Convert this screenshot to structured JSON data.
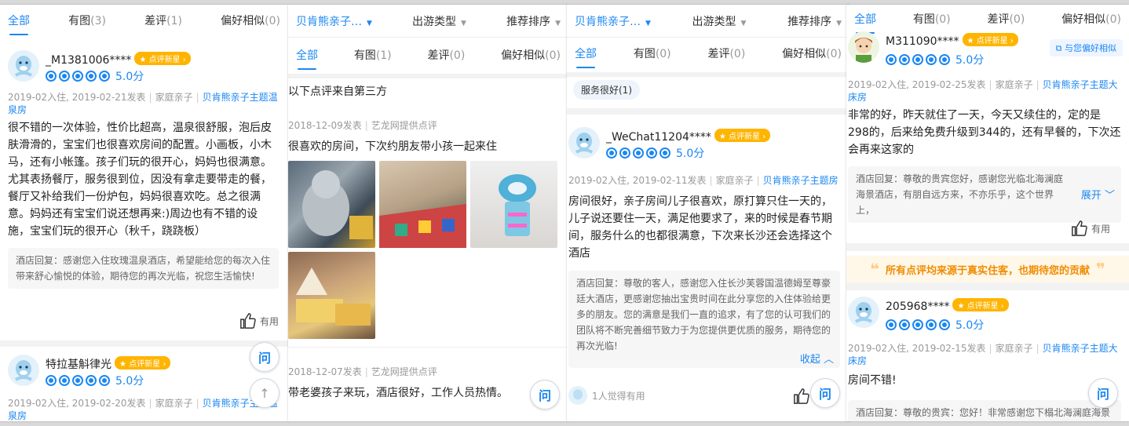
{
  "panel1": {
    "tabs": [
      {
        "label": "全部",
        "count": ""
      },
      {
        "label": "有图",
        "count": "(3)"
      },
      {
        "label": "差评",
        "count": "(1)"
      },
      {
        "label": "偏好相似",
        "count": "(0)"
      }
    ],
    "review1": {
      "user": "_M1381006****",
      "badge": "点评新星",
      "score": "5.0分",
      "stay": "2019-02入住,",
      "posted": "2019-02-21发表",
      "trip": "家庭亲子",
      "room": "贝肯熊亲子主题温泉房",
      "text": "很不错的一次体验，性价比超高，温泉很舒服，泡后皮肤滑滑的，宝宝们也很喜欢房间的配置。小画板，小木马，还有小帐篷。孩子们玩的很开心，妈妈也很满意。尤其表扬餐厅，服务很到位，因没有拿走要带走的餐，餐厅又补给我们一份炉包，妈妈很喜欢吃。总之很满意。妈妈还有宝宝们说还想再来:)周边也有不错的设施，宝宝们玩的很开心（秋千，跷跷板）",
      "reply": "酒店回复：感谢您入住玫瑰温泉酒店，希望能给您的每次入住带来舒心愉悦的体验，期待您的再次光临，祝您生活愉快!",
      "helpful": "有用"
    },
    "review2": {
      "user": "特拉基斛律光",
      "badge": "点评新星",
      "score": "5.0分",
      "stay": "2019-02入住,",
      "posted": "2019-02-20发表",
      "trip": "家庭亲子",
      "room": "贝肯熊亲子主题温泉房"
    },
    "ask": "问",
    "top": "↑"
  },
  "panel2": {
    "filters": {
      "hotel": "贝肯熊亲子…",
      "trip": "出游类型",
      "sort": "推荐排序"
    },
    "tabs": [
      {
        "label": "全部",
        "count": ""
      },
      {
        "label": "有图",
        "count": "(1)"
      },
      {
        "label": "差评",
        "count": "(0)"
      },
      {
        "label": "偏好相似",
        "count": "(0)"
      }
    ],
    "third_party_note": "以下点评来自第三方",
    "review1": {
      "posted": "2018-12-09发表",
      "source": "艺龙网提供点评",
      "text": "很喜欢的房间，下次约朋友带小孩一起来住"
    },
    "review2": {
      "posted": "2018-12-07发表",
      "source": "艺龙网提供点评",
      "text": "带老婆孩子来玩，酒店很好，工作人员热情。"
    },
    "ask": "问"
  },
  "panel3": {
    "filters": {
      "hotel": "贝肯熊亲子…",
      "trip": "出游类型",
      "sort": "推荐排序"
    },
    "tabs": [
      {
        "label": "全部",
        "count": ""
      },
      {
        "label": "有图",
        "count": "(0)"
      },
      {
        "label": "差评",
        "count": "(0)"
      },
      {
        "label": "偏好相似",
        "count": "(0)"
      }
    ],
    "chip": "服务很好(1)",
    "review": {
      "user": "_WeChat11204****",
      "badge": "点评新星",
      "score": "5.0分",
      "stay": "2019-02入住,",
      "posted": "2019-02-11发表",
      "trip": "家庭亲子",
      "room": "贝肯熊亲子主题房",
      "text": "房间很好，亲子房间儿子很喜欢，原打算只住一天的，儿子说还要住一天，满足他要求了，来的时候是春节期间，服务什么的也都很满意，下次来长沙还会选择这个酒店",
      "reply": "酒店回复：尊敬的客人，感谢您入住长沙芙蓉国温德姆至尊豪廷大酒店，更感谢您抽出宝贵时间在此分享您的入住体验给更多的朋友。您的满意是我们一直的追求，有了您的认可我们的团队将不断完善细节致力于为您提供更优质的服务，期待您的再次光临!",
      "collapse": "收起",
      "helpful_count": "1人觉得有用"
    },
    "ask": "问"
  },
  "panel4": {
    "tabs": [
      {
        "label": "全部",
        "count": ""
      },
      {
        "label": "有图",
        "count": "(0)"
      },
      {
        "label": "差评",
        "count": "(0)"
      },
      {
        "label": "偏好相似",
        "count": "(0)"
      }
    ],
    "similar": "与您偏好相似",
    "review1": {
      "user": "M311090****",
      "badge": "点评新星",
      "score": "5.0分",
      "stay": "2019-02入住,",
      "posted": "2019-02-25发表",
      "trip": "家庭亲子",
      "room": "贝肯熊亲子主题大床房",
      "text": "非常的好，昨天就住了一天，今天又续住的，定的是298的，后来给免费升级到344的，还有早餐的，下次还会再来这家的",
      "reply": "酒店回复：尊敬的贵宾您好，感谢您光临北海澜庭海景酒店，有朋自远方来，不亦乐乎，这个世界上，",
      "expand": "展开",
      "helpful": "有用"
    },
    "banner": "所有点评均来源于真实住客，也期待您的贡献",
    "review2": {
      "user": "205968****",
      "badge": "点评新星",
      "score": "5.0分",
      "stay": "2019-02入住,",
      "posted": "2019-02-15发表",
      "trip": "家庭亲子",
      "room": "贝肯熊亲子主题大床房",
      "text": "房间不错!",
      "reply": "酒店回复：尊敬的贵宾：您好！非常感谢您下榻北海澜庭海景酒店并在这个平台与我们分享您的体验"
    },
    "ask": "问"
  }
}
